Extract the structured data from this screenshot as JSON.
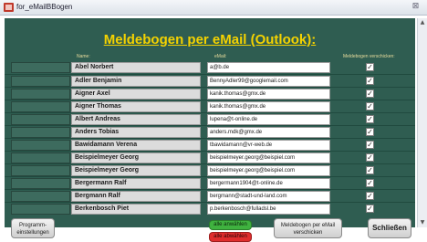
{
  "window": {
    "title": "for_eMailBBogen",
    "close_glyph": "⊠"
  },
  "form": {
    "heading": "Meldebogen per eMail (Outlook):",
    "columns": {
      "name": "Name:",
      "email": "eMail:",
      "send": "Meldebogen verschicken:"
    },
    "rows": [
      {
        "name": "Abel Norbert",
        "email": "a@b.de",
        "checked": true
      },
      {
        "name": "Adler Benjamin",
        "email": "BennyAdler99@googlemail.com",
        "checked": true
      },
      {
        "name": "Aigner Axel",
        "email": "kanik.thomas@gmx.de",
        "checked": true
      },
      {
        "name": "Aigner Thomas",
        "email": "kanik.thomas@gmx.de",
        "checked": true
      },
      {
        "name": "Albert Andreas",
        "email": "lupena@t-online.de",
        "checked": true
      },
      {
        "name": "Anders Tobias",
        "email": "anders.mdk@gmx.de",
        "checked": true
      },
      {
        "name": "Bawidamann Verena",
        "email": "tbawidamann@vr-web.de",
        "checked": true
      },
      {
        "name": "Beispielmeyer Georg",
        "email": "beispielmeyer.georg@beispiel.com",
        "checked": true
      },
      {
        "name": "Beispielmeyer Georg",
        "email": "beispielmeyer.georg@beispiel.com",
        "checked": true
      },
      {
        "name": "Bergermann Ralf",
        "email": "bergermann1904@t-online.de",
        "checked": true
      },
      {
        "name": "Bergmann Ralf",
        "email": "bergmann@stadt-und-land.com",
        "checked": true
      },
      {
        "name": "Berkenbosch Piet",
        "email": "p.berkenbosch@fulladsl.be",
        "checked": true
      }
    ],
    "check_glyph": "✓"
  },
  "buttons": {
    "settings": "Programm-\neinstellungen",
    "select_all": "alle anwählen",
    "select_none": "alle abwählen",
    "send": "Meldebogen per eMail\nverschicken",
    "close": "Schließen"
  },
  "colors": {
    "form_bg": "#2f5d51",
    "heading": "#f5d300",
    "select_all": "#3fb23f",
    "select_none": "#e02d2d"
  }
}
